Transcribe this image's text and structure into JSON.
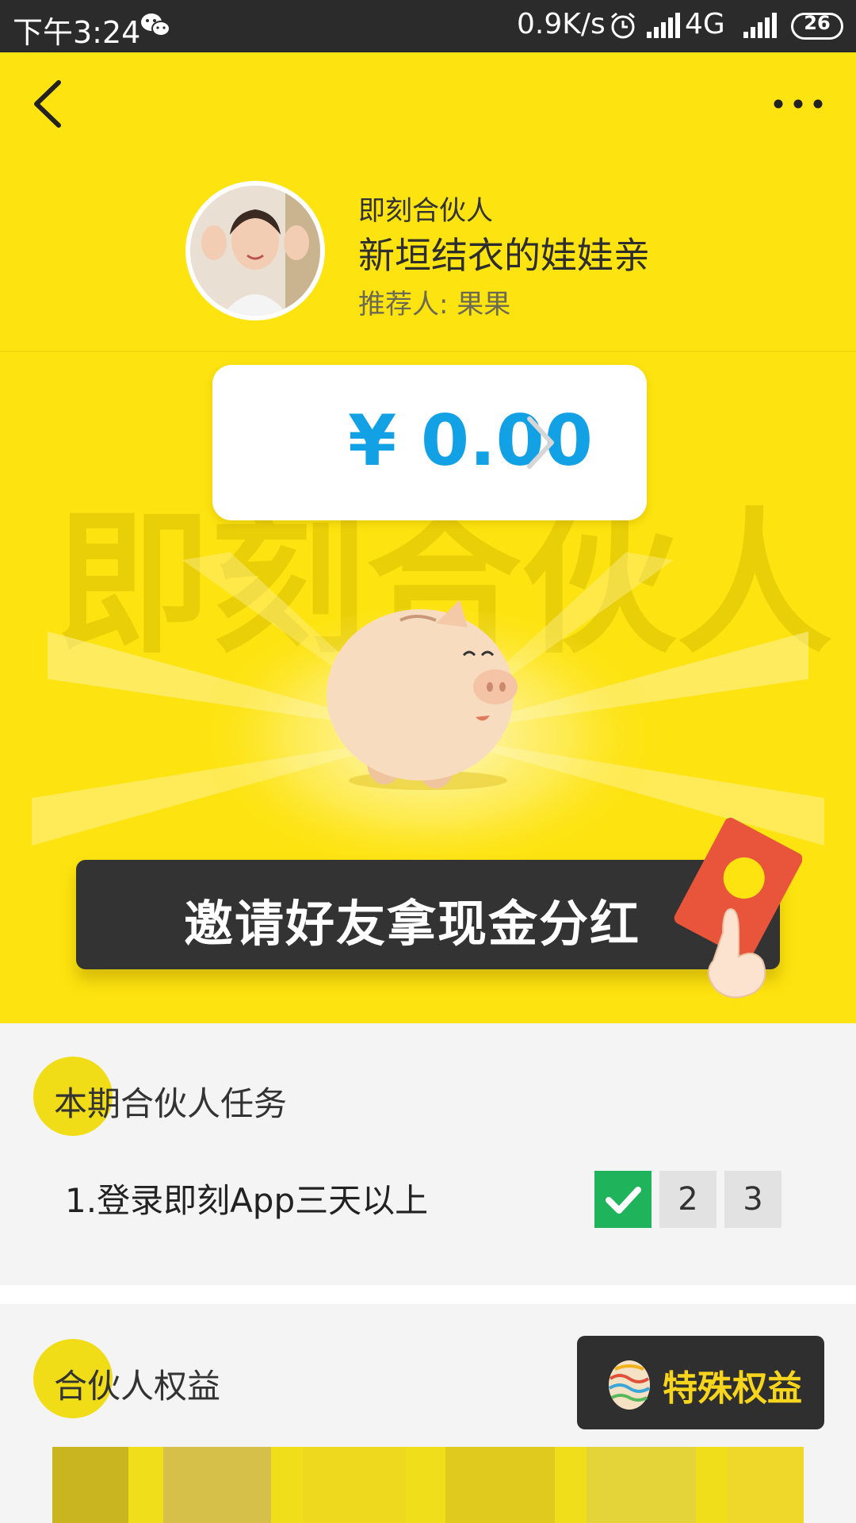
{
  "status_bar": {
    "time": "下午3:24",
    "net_speed": "0.9K/s",
    "network": "4G",
    "battery": "26",
    "icons": [
      "wechat-icon",
      "alarm-icon",
      "signal-icon",
      "signal-icon",
      "battery-icon"
    ]
  },
  "header": {
    "partner_label": "即刻合伙人",
    "user_name": "新垣结衣的娃娃亲",
    "referrer": "推荐人: 果果"
  },
  "hero": {
    "watermark": "即刻合伙人",
    "balance": "¥ 0.00",
    "invite_button": "邀请好友拿现金分红"
  },
  "tasks": {
    "title": "本期合伙人任务",
    "items": [
      {
        "label": "1.登录即刻App三天以上",
        "days": [
          "",
          "2",
          "3"
        ],
        "completed_days": 1
      }
    ]
  },
  "rights": {
    "title": "合伙人权益",
    "special_button": "特殊权益"
  },
  "colors": {
    "status_bar": "#2b2b2b",
    "hero_yellow": "#fde30f",
    "balance_blue": "#13a1e6",
    "dark_button": "#333333",
    "done_green": "#1fb35c",
    "special_gold": "#f7d51c"
  }
}
